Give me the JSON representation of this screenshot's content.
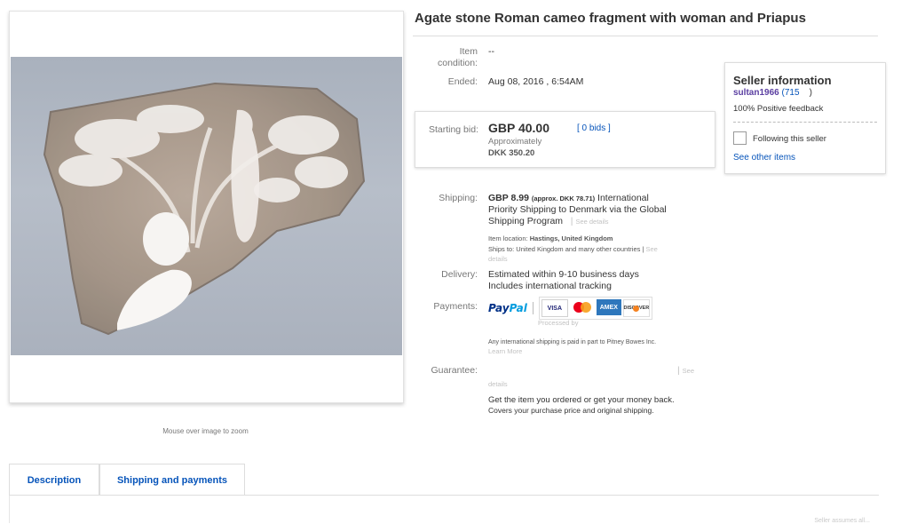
{
  "listing": {
    "title": "Agate stone Roman cameo fragment with woman and Priapus",
    "zoom_hint": "Mouse over image to zoom"
  },
  "details": {
    "condition_label": "Item condition:",
    "condition_value": "--",
    "ended_label": "Ended:",
    "ended_value": "Aug 08, 2016 , 6:54AM"
  },
  "bid": {
    "label": "Starting bid:",
    "price": "GBP 40.00",
    "bids_link": "[ 0 bids ]",
    "approx_label": "Approximately",
    "approx_value": "DKK 350.20"
  },
  "seller": {
    "title": "Seller information",
    "name": "sultan1966",
    "score": "(715",
    "score_close": ")",
    "feedback": "100% Positive feedback",
    "follow_label": "Following this seller",
    "see_other": "See other items"
  },
  "shipping": {
    "label": "Shipping:",
    "price": "GBP 8.99",
    "approx": "(approx. DKK 78.71)",
    "line1": "International",
    "line2": "Priority Shipping to Denmark  via the Global",
    "line3": "Shipping Program",
    "see_details": "See details",
    "location_label": "Item location:",
    "location_value": "Hastings, United Kingdom",
    "ships_label": "Ships to:",
    "ships_value": "United Kingdom and many other countries |",
    "ships_see": "See",
    "ships_details": "details"
  },
  "delivery": {
    "label": "Delivery:",
    "line1": "Estimated within 9-10 business days",
    "line2": "Includes international tracking"
  },
  "payments": {
    "label": "Payments:",
    "paypal_a": "Pay",
    "paypal_b": "Pal",
    "processed": "Processed by",
    "visa": "VISA",
    "amex": "AMEX",
    "discover": "DISCOVER",
    "note": "Any international shipping is paid in part to Pitney Bowes Inc.",
    "learn_more": "Learn More"
  },
  "guarantee": {
    "label": "Guarantee:",
    "see": "See",
    "details": "details",
    "line1": "Get the item you ordered or get your money back.",
    "line2": "Covers your purchase price and original shipping."
  },
  "tabs": [
    {
      "label": "Description"
    },
    {
      "label": "Shipping and payments"
    }
  ],
  "footer": {
    "faint_text": "Seller assumes all..."
  },
  "colors": {
    "link": "#0654ba",
    "seller_name": "#5a3ea1",
    "paypal_dark": "#003087",
    "paypal_light": "#009cde"
  }
}
